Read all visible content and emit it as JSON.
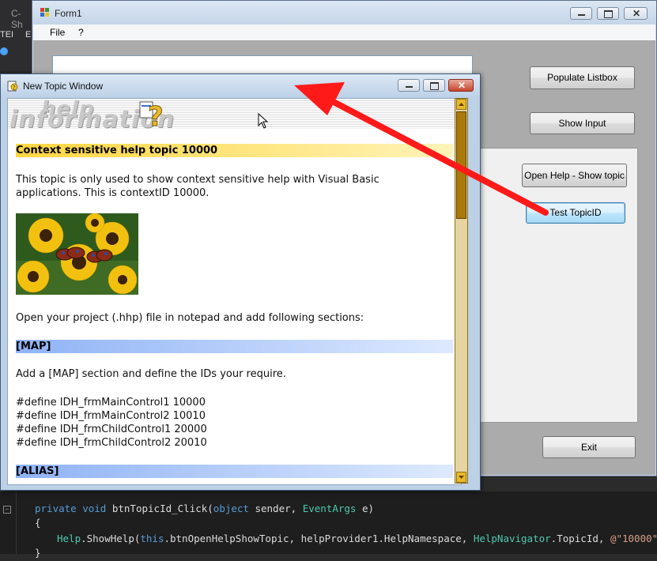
{
  "ide": {
    "tab_label": "C-Sh",
    "left_labels": [
      "TEI",
      "E"
    ],
    "code_lines": [
      {
        "parts": [
          [
            "kw",
            "private "
          ],
          [
            "kw",
            "void "
          ],
          [
            "fn",
            "btnTopicId_Click("
          ],
          [
            "kw",
            "object "
          ],
          [
            "fn",
            "sender, "
          ],
          [
            "ty",
            "EventArgs "
          ],
          [
            "fn",
            "e)"
          ]
        ]
      },
      {
        "parts": [
          [
            "fn",
            "{"
          ]
        ]
      },
      {
        "parts": [
          [
            "ty",
            "Help"
          ],
          [
            "fn",
            ".ShowHelp("
          ],
          [
            "kw",
            "this"
          ],
          [
            "fn",
            ".btnOpenHelpShowTopic, helpProvider1.HelpNamespace, "
          ],
          [
            "ty",
            "HelpNavigator"
          ],
          [
            "fn",
            ".TopicId, "
          ],
          [
            "st",
            "@\"10000\""
          ],
          [
            "fn",
            ");"
          ]
        ]
      },
      {
        "parts": [
          [
            "fn",
            "}"
          ]
        ]
      }
    ]
  },
  "form1": {
    "title": "Form1",
    "menu": [
      "File",
      "?"
    ],
    "buttons": {
      "populate": "Populate Listbox",
      "show_input": "Show Input",
      "open_help": "Open Help - Show topic",
      "test_topic": "Test TopicID",
      "exit": "Exit"
    }
  },
  "topic_window": {
    "title": "New Topic Window",
    "banner_logo": [
      "help",
      "information"
    ],
    "heading1": "Context sensitive help topic 10000",
    "para1_line1": "This topic is only used to show context sensitive help with Visual Basic",
    "para1_line2": "applications. This is contextID 10000.",
    "para2": "Open your project (.hhp) file in notepad and add following sections:",
    "heading_map": "[MAP]",
    "para3": "Add a [MAP] section and define the IDs your require.",
    "defines": [
      "#define IDH_frmMainControl1 10000",
      "#define IDH_frmMainControl2 10010",
      "#define IDH_frmChildControl1 20000",
      "#define IDH_frmChildControl2 20010"
    ],
    "heading_alias": "[ALIAS]"
  },
  "colors": {
    "arrow": "#ff1a1a",
    "heading_yellow": "#ffd640",
    "heading_blue": "#8fb3f5",
    "scrollbar": "#e8b92a"
  },
  "icons": [
    "form-icon",
    "help-window-icon",
    "minimize-icon",
    "maximize-icon",
    "close-icon",
    "mouse-cursor-icon",
    "question-mark-icon"
  ]
}
